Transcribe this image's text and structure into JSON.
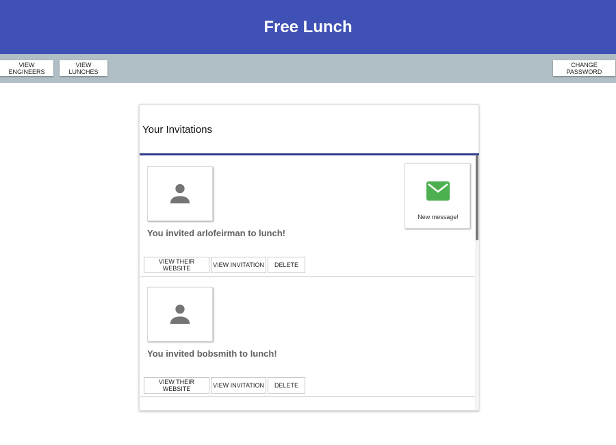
{
  "app": {
    "title": "Free Lunch"
  },
  "toolbar": {
    "view_engineers": "View Engineers",
    "view_lunches": "View Lunches",
    "change_password": "Change Password"
  },
  "panel": {
    "title": "Your Invitations"
  },
  "invitations": [
    {
      "text": "You invited arlofeirman to lunch!",
      "btn_website": "View their website",
      "btn_invitation": "View invitation",
      "btn_delete": "Delete",
      "message": {
        "label": "New message!",
        "icon": "mail-icon",
        "color": "#4caf50"
      }
    },
    {
      "text": "You invited bobsmith to lunch!",
      "btn_website": "View their website",
      "btn_invitation": "View invitation",
      "btn_delete": "Delete"
    }
  ],
  "colors": {
    "header": "#3f51b5",
    "toolbar": "#b0bec5",
    "divider": "#1a237e",
    "avatar_icon": "#757575",
    "message_icon": "#4caf50"
  }
}
